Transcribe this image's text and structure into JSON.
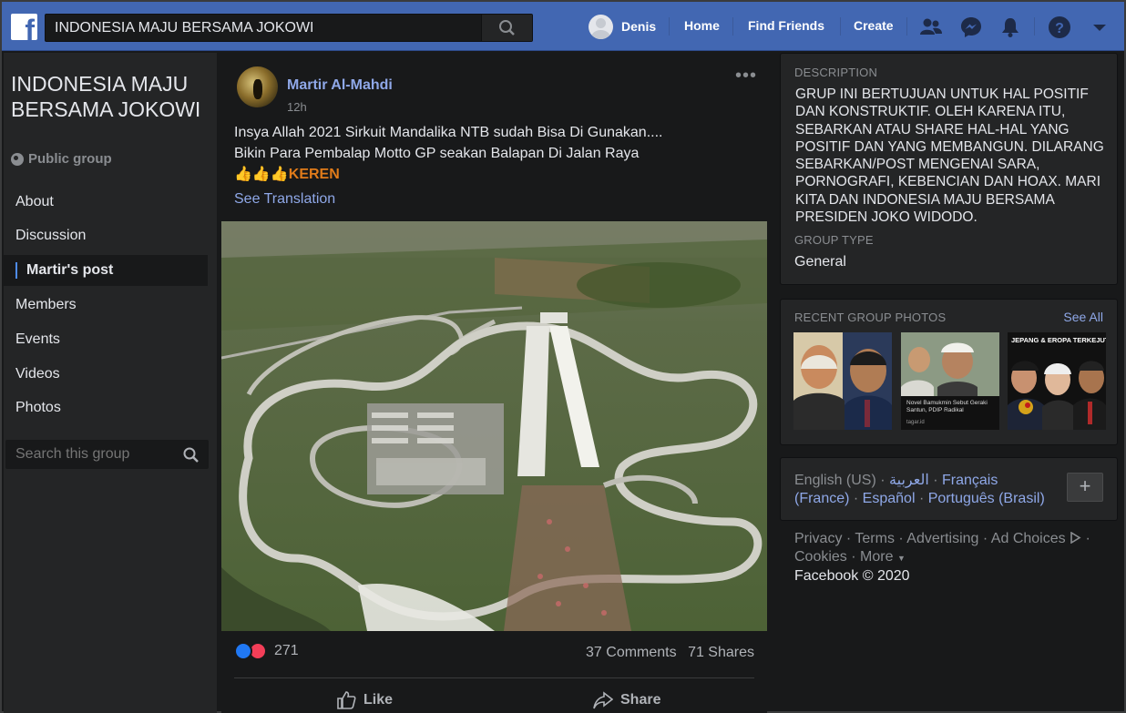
{
  "topbar": {
    "search_value": "INDONESIA MAJU BERSAMA JOKOWI",
    "user_name": "Denis",
    "home_label": "Home",
    "find_friends_label": "Find Friends",
    "create_label": "Create"
  },
  "group": {
    "title": "INDONESIA MAJU BERSAMA JOKOWI",
    "privacy": "Public group",
    "nav": {
      "about": "About",
      "discussion": "Discussion",
      "current_post": "Martir's post",
      "members": "Members",
      "events": "Events",
      "videos": "Videos",
      "photos": "Photos"
    },
    "search_placeholder": "Search this group"
  },
  "post": {
    "author": "Martir Al-Mahdi",
    "time": "12h",
    "more": "•••",
    "line1": "Insya Allah 2021 Sirkuit Mandalika NTB sudah Bisa Di Gunakan....",
    "line2": "Bikin Para Pembalap Motto GP seakan Balapan Di Jalan Raya",
    "emojis": "👍👍👍",
    "keren": "KEREN",
    "see_translation": "See Translation",
    "reaction_count": "271",
    "comments": "37 Comments",
    "shares": "71 Shares",
    "like_label": "Like",
    "share_label": "Share"
  },
  "sidebar_right": {
    "description_label": "DESCRIPTION",
    "description_text": "GRUP INI BERTUJUAN UNTUK HAL POSITIF DAN KONSTRUKTIF. OLEH KARENA ITU, SEBARKAN ATAU SHARE HAL-HAL YANG POSITIF DAN YANG MEMBANGUN. DILARANG SEBARKAN/POST MENGENAI SARA, PORNOGRAFI, KEBENCIAN DAN HOAX. MARI KITA DAN INDONESIA MAJU BERSAMA PRESIDEN JOKO WIDODO.",
    "group_type_label": "GROUP TYPE",
    "group_type": "General",
    "recent_photos_label": "RECENT GROUP PHOTOS",
    "see_all": "See All",
    "photo2_caption": "Novel Bamukmin Sebut Geraki Santun, PDIP Radikal",
    "photo2_source": "tagar.id",
    "photo3_caption": "JEPANG & EROPA TERKEJUT"
  },
  "languages": {
    "current": "English (US)",
    "arabic": "العربية",
    "french": "Français (France)",
    "spanish": "Español",
    "portuguese": "Português (Brasil)",
    "add": "+"
  },
  "footer": {
    "privacy": "Privacy",
    "terms": "Terms",
    "advertising": "Advertising",
    "ad_choices": "Ad Choices",
    "cookies": "Cookies",
    "more": "More",
    "copyright": "Facebook © 2020"
  },
  "colors": {
    "brand_blue": "#4267b2",
    "link_blue": "#8fa8e8",
    "keren_orange": "#e07b1a",
    "like_blue": "#2078f4",
    "love_red": "#f33e58"
  }
}
